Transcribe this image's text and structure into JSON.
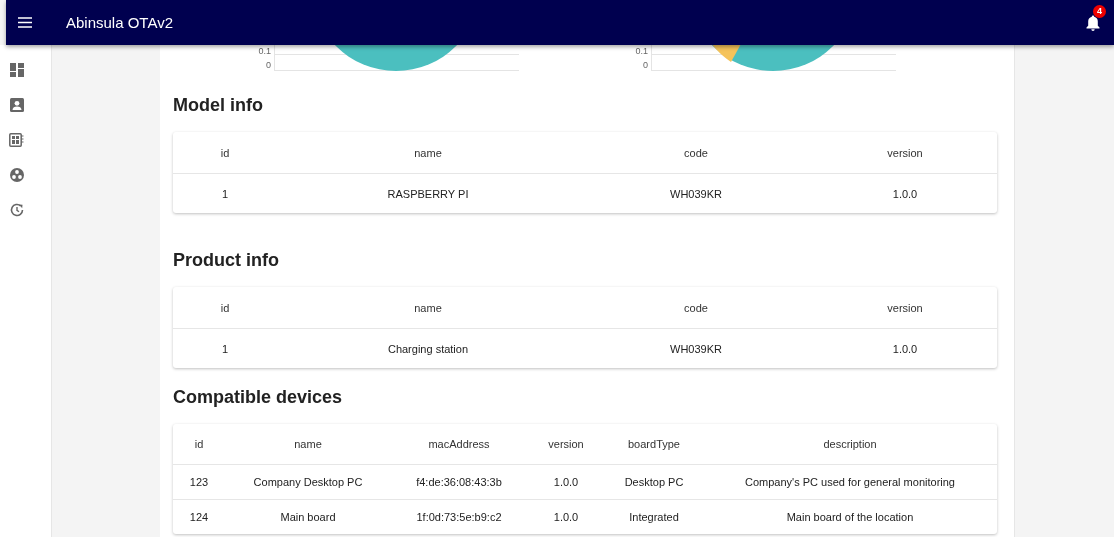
{
  "app_bar": {
    "title": "Abinsula OTAv2",
    "notifications": "4"
  },
  "sidebar": {
    "items": [
      {
        "kind": "dashboard"
      },
      {
        "kind": "account"
      },
      {
        "kind": "board"
      },
      {
        "kind": "group"
      },
      {
        "kind": "history"
      }
    ]
  },
  "charts": [
    {
      "yticks": [
        "0.1",
        "0"
      ],
      "slices": [
        {
          "color": "#4bbfbf"
        }
      ]
    },
    {
      "yticks": [
        "0.1",
        "0"
      ],
      "slices": [
        {
          "color": "#4bbfbf"
        },
        {
          "color": "#f5c35a"
        }
      ]
    }
  ],
  "sections": [
    {
      "title": "Model info",
      "columns": [
        "id",
        "name",
        "code",
        "version"
      ],
      "rows": [
        [
          "1",
          "RASPBERRY PI",
          "WH039KR",
          "1.0.0"
        ]
      ]
    },
    {
      "title": "Product info",
      "columns": [
        "id",
        "name",
        "code",
        "version"
      ],
      "rows": [
        [
          "1",
          "Charging station",
          "WH039KR",
          "1.0.0"
        ]
      ]
    },
    {
      "title": "Compatible devices",
      "columns": [
        "id",
        "name",
        "macAddress",
        "version",
        "boardType",
        "description"
      ],
      "rows": [
        [
          "123",
          "Company Desktop PC",
          "f4:de:36:08:43:3b",
          "1.0.0",
          "Desktop PC",
          "Company's PC used for general monitoring"
        ],
        [
          "124",
          "Main board",
          "1f:0d:73:5e:b9:c2",
          "1.0.0",
          "Integrated",
          "Main board of the location"
        ]
      ]
    }
  ]
}
